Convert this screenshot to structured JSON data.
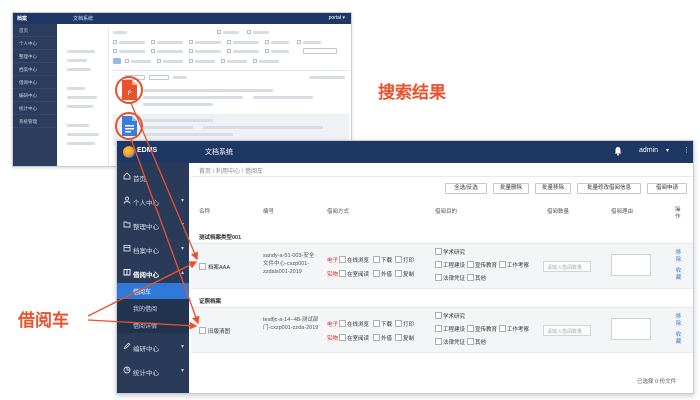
{
  "annotations": {
    "search_results": "搜索结果",
    "borrow_cart": "借阅车"
  },
  "colors": {
    "topbar": "#1e3765",
    "sidebar": "#2a3b59",
    "accent": "#2f7ad9",
    "highlight": "#e8522c",
    "required": "#d7261e"
  },
  "back_window": {
    "brand": "档案",
    "title": "文档系统",
    "user": "portal ▾",
    "nav": [
      "首页",
      "个人中心",
      "整理中心",
      "档案中心",
      "借阅中心",
      "编研中心",
      "统计中心",
      "系统管理"
    ],
    "result_icons": [
      "pdf-file-icon",
      "doc-file-icon"
    ]
  },
  "front_window": {
    "brand": "EDMS",
    "system_title": "文档系统",
    "user": "admin",
    "breadcrumb": "首页 / 利用中心 / 借阅车",
    "nav": [
      {
        "label": "首页",
        "icon": "home-icon",
        "arrow": ""
      },
      {
        "label": "个人中心",
        "icon": "user-icon",
        "arrow": "▾"
      },
      {
        "label": "整理中心",
        "icon": "folder-icon",
        "arrow": "▾"
      },
      {
        "label": "档案中心",
        "icon": "archive-icon",
        "arrow": "▾"
      },
      {
        "label": "借阅中心",
        "icon": "borrow-icon",
        "arrow": "▴"
      },
      {
        "label": "编研中心",
        "icon": "edit-icon",
        "arrow": "▾"
      },
      {
        "label": "统计中心",
        "icon": "stats-icon",
        "arrow": "▾"
      }
    ],
    "subnav": [
      "借阅车",
      "我的借阅",
      "借阅详情"
    ],
    "toolbar": [
      "全选/反选",
      "批量删除",
      "批量移除",
      "批量修改借阅信息",
      "借阅申请"
    ],
    "columns": [
      "名称",
      "编号",
      "借阅方式",
      "借阅目的",
      "借阅数量",
      "借阅理由",
      "操作"
    ],
    "methods": {
      "electronic": "电子",
      "physical": "实物",
      "e_options": [
        "在线浏览",
        "下载",
        "打印"
      ],
      "p_options": [
        "在室阅读",
        "外借",
        "复制"
      ]
    },
    "purposes": [
      "学术研究",
      "工程建设",
      "宣传教育",
      "工作考察",
      "法律凭证",
      "其他"
    ],
    "quantity_placeholder": "请输入借阅数量",
    "actions": [
      "移除",
      "收藏"
    ],
    "groups": [
      {
        "title": "测试档案类型001",
        "name": "档案AAA",
        "code": "sandy-a-51-003-安全文件中心-cxzp001-zzdals001-2019"
      },
      {
        "title": "证照档案",
        "name": "旧版清图",
        "code": "testfjc-a-14--48-测试部门-cxzp001-zzda-2019"
      }
    ],
    "footer": "已选择 0 份文件"
  }
}
